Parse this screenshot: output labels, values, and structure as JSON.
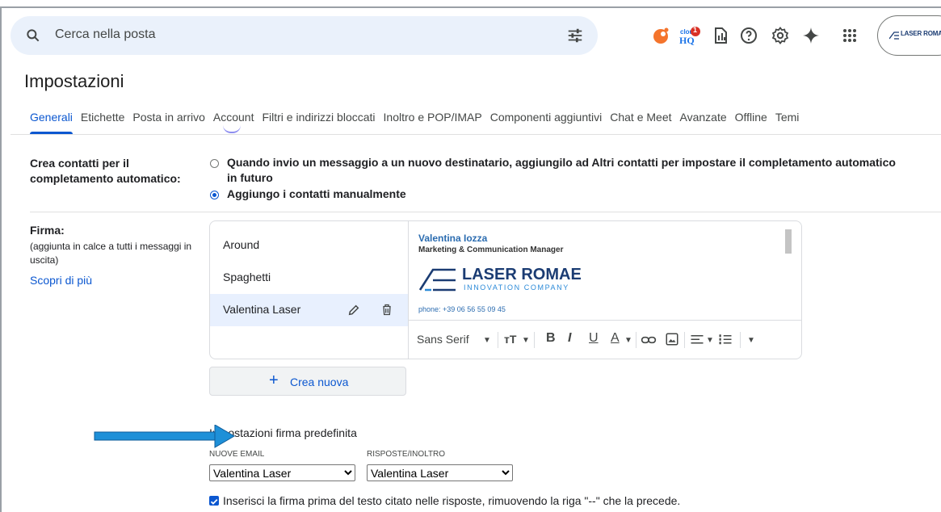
{
  "search": {
    "placeholder": "Cerca nella posta"
  },
  "topbar": {
    "icons": [
      "bug-icon",
      "cloudhq-icon",
      "stats-icon",
      "help-icon",
      "settings-icon",
      "gemini-icon",
      "apps-icon"
    ],
    "account_logo_text": "LASER ROMAE",
    "cloudhq_badge": "1"
  },
  "page": {
    "title": "Impostazioni"
  },
  "tabs": [
    {
      "label": "Generali"
    },
    {
      "label": "Etichette"
    },
    {
      "label": "Posta in arrivo"
    },
    {
      "label": "Account"
    },
    {
      "label": "Filtri e indirizzi bloccati"
    },
    {
      "label": "Inoltro e POP/IMAP"
    },
    {
      "label": "Componenti aggiuntivi"
    },
    {
      "label": "Chat e Meet"
    },
    {
      "label": "Avanzate"
    },
    {
      "label": "Offline"
    },
    {
      "label": "Temi"
    }
  ],
  "contacts": {
    "label_line1": "Crea contatti per il",
    "label_line2": "completamento automatico:",
    "option1_line1": "Quando invio un messaggio a un nuovo destinatario, aggiungilo ad Altri contatti per impostare il completamento automatico",
    "option1_line2": "in futuro",
    "option2": "Aggiungo i contatti manualmente",
    "selected": "option2"
  },
  "signature": {
    "label": "Firma:",
    "desc": "(aggiunta in calce a tutti i messaggi in uscita)",
    "learn_more": "Scopri di più",
    "items": [
      {
        "label": "Around"
      },
      {
        "label": "Spaghetti"
      },
      {
        "label": "Valentina Laser"
      }
    ],
    "selected": "Valentina Laser",
    "preview": {
      "name": "Valentina Iozza",
      "role": "Marketing & Communication Manager",
      "company": "LASER ROMAE",
      "company_sub": "INNOVATION COMPANY",
      "cut_line": "phone:        +39 06 56 55 09 45"
    },
    "toolbar": {
      "font": "Sans Serif",
      "bold": "B",
      "italic": "I",
      "underline": "U",
      "color": "A"
    },
    "new_button": "Crea nuova"
  },
  "defaults": {
    "heading": "Impostazioni firma predefinita",
    "new_email_label": "NUOVE EMAIL",
    "reply_label": "RISPOSTE/INOLTRO",
    "new_email_value": "Valentina Laser",
    "reply_value": "Valentina Laser",
    "checkbox_label": "Inserisci la firma prima del testo citato nelle risposte, rimuovendo la riga \"--\" che la precede.",
    "checkbox_checked": true
  },
  "colors": {
    "accent": "#0b57d0",
    "search_bg": "#eaf1fb",
    "arrow": "#1e90d8"
  }
}
